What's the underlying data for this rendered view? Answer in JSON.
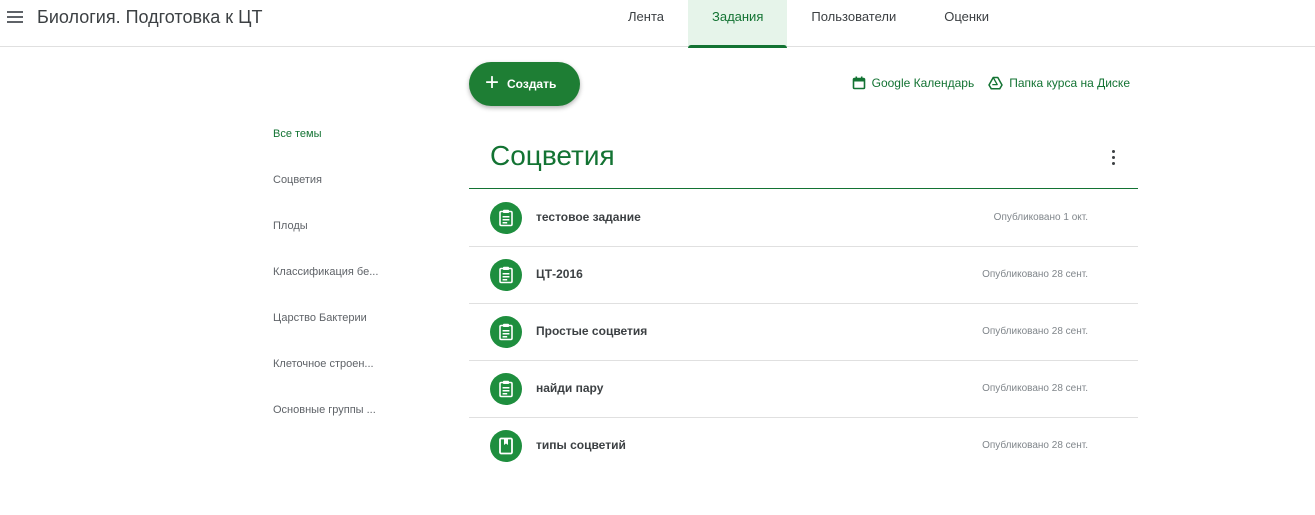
{
  "header": {
    "menu_icon": "hamburger-menu-icon",
    "course_title": "Биология. Подготовка к ЦТ",
    "tabs": [
      {
        "label": "Лента",
        "active": false
      },
      {
        "label": "Задания",
        "active": true
      },
      {
        "label": "Пользователи",
        "active": false
      },
      {
        "label": "Оценки",
        "active": false
      }
    ]
  },
  "toolbar": {
    "create_label": "Создать",
    "calendar_label": "Google Календарь",
    "drive_label": "Папка курса на Диске"
  },
  "topics": [
    {
      "label": "Все темы",
      "active": true
    },
    {
      "label": "Соцветия",
      "active": false
    },
    {
      "label": "Плоды",
      "active": false
    },
    {
      "label": "Классификация бе...",
      "active": false
    },
    {
      "label": "Царство Бактерии",
      "active": false
    },
    {
      "label": "Клеточное строен...",
      "active": false
    },
    {
      "label": "Основные группы ...",
      "active": false
    }
  ],
  "section": {
    "title": "Соцветия",
    "items": [
      {
        "title": "тестовое задание",
        "date": "Опубликовано 1 окт.",
        "icon": "assignment-icon"
      },
      {
        "title": "ЦТ-2016",
        "date": "Опубликовано 28 сент.",
        "icon": "assignment-icon"
      },
      {
        "title": "Простые соцветия",
        "date": "Опубликовано 28 сент.",
        "icon": "assignment-icon"
      },
      {
        "title": "найди пару",
        "date": "Опубликовано 28 сент.",
        "icon": "assignment-icon"
      },
      {
        "title": "типы соцветий",
        "date": "Опубликовано 28 сент.",
        "icon": "material-icon"
      }
    ]
  },
  "colors": {
    "accent": "#137333",
    "accent_fill": "#1e8e3e",
    "active_tab_bg": "#e6f4ea"
  }
}
